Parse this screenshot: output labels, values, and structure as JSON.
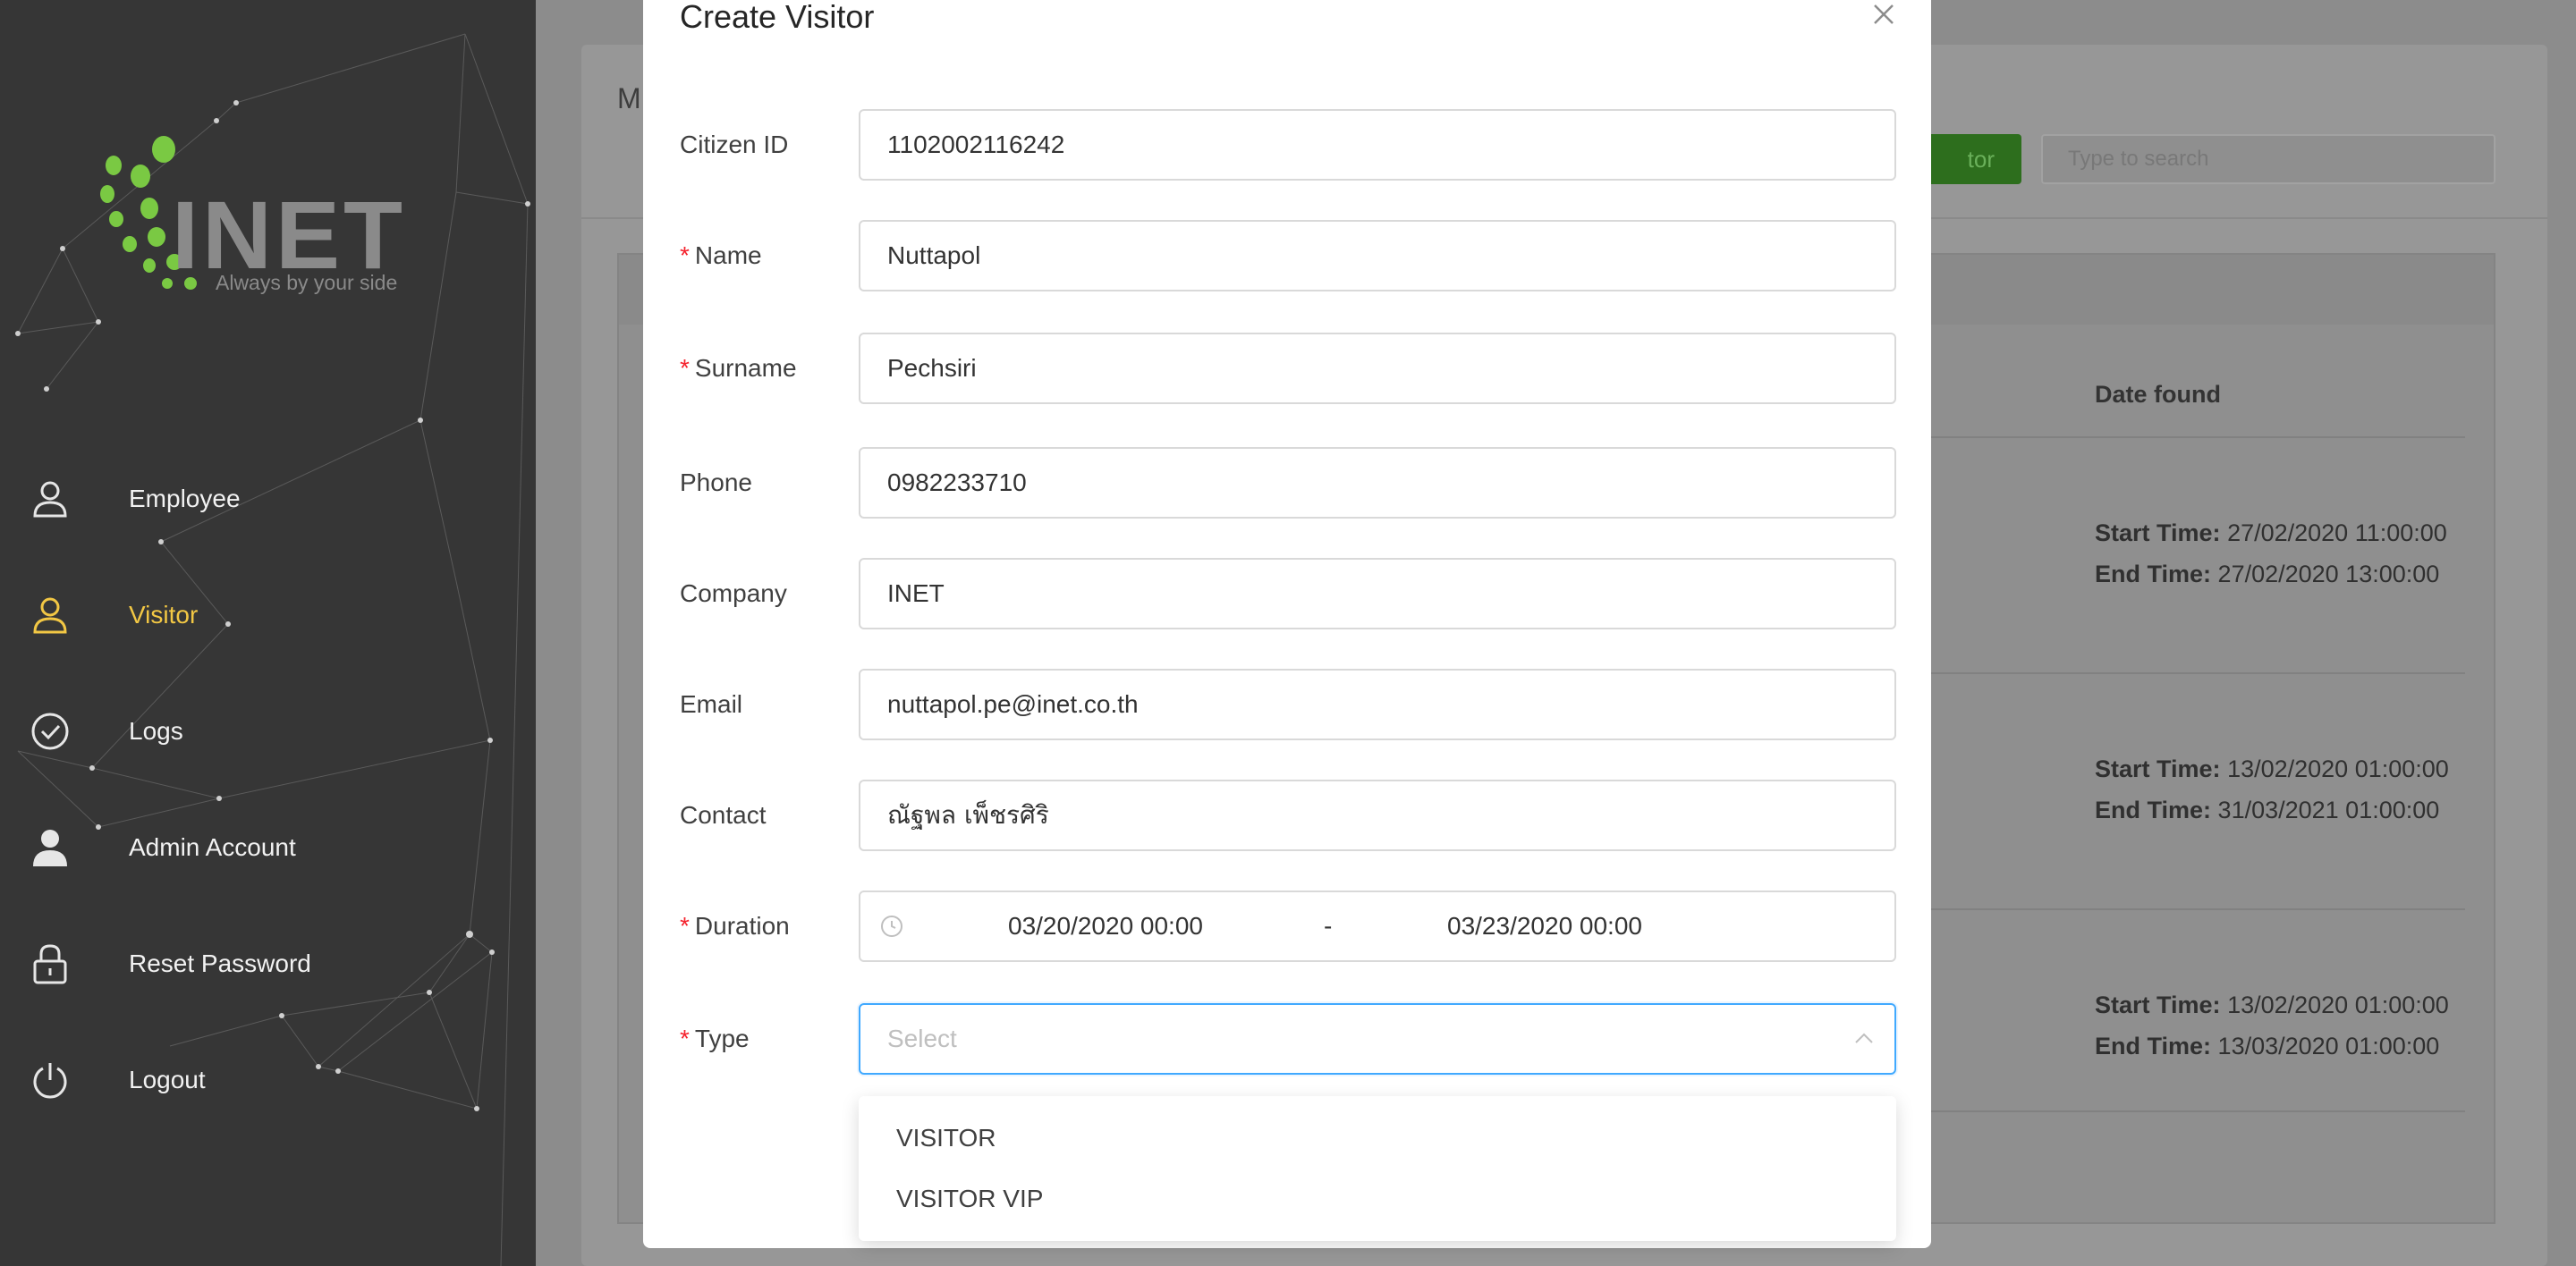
{
  "sidebar": {
    "logo": {
      "text": "INET",
      "tagline": "Always by your side"
    },
    "items": [
      {
        "label": "Employee",
        "icon": "user-icon",
        "active": false
      },
      {
        "label": "Visitor",
        "icon": "user-icon",
        "active": true
      },
      {
        "label": "Logs",
        "icon": "check-circle-icon",
        "active": false
      },
      {
        "label": "Admin Account",
        "icon": "user-filled-icon",
        "active": false
      },
      {
        "label": "Reset Password",
        "icon": "lock-icon",
        "active": false
      },
      {
        "label": "Logout",
        "icon": "power-icon",
        "active": false
      }
    ]
  },
  "background": {
    "title_fragment": "M",
    "add_button_fragment": "tor",
    "search_placeholder": "Type to search",
    "column_title": "Date found",
    "rows": [
      {
        "start_label": "Start Time:",
        "start": "27/02/2020 11:00:00",
        "end_label": "End Time:",
        "end": "27/02/2020 13:00:00"
      },
      {
        "start_label": "Start Time:",
        "start": "13/02/2020 01:00:00",
        "end_label": "End Time:",
        "end": "31/03/2021 01:00:00"
      },
      {
        "start_label": "Start Time:",
        "start": "13/02/2020 01:00:00",
        "end_label": "End Time:",
        "end": "13/03/2020 01:00:00"
      }
    ]
  },
  "modal": {
    "title": "Create Visitor",
    "fields": {
      "citizen_id": {
        "label": "Citizen ID",
        "value": "1102002116242",
        "required": false
      },
      "name": {
        "label": "Name",
        "value": "Nuttapol",
        "required": true
      },
      "surname": {
        "label": "Surname",
        "value": "Pechsiri",
        "required": true
      },
      "phone": {
        "label": "Phone",
        "value": "0982233710",
        "required": false
      },
      "company": {
        "label": "Company",
        "value": "INET",
        "required": false
      },
      "email": {
        "label": "Email",
        "value": "nuttapol.pe@inet.co.th",
        "required": false
      },
      "contact": {
        "label": "Contact",
        "value": "ณัฐพล เพ็ชรศิริ",
        "required": false
      },
      "duration": {
        "label": "Duration",
        "start": "03/20/2020 00:00",
        "separator": "-",
        "end": "03/23/2020 00:00",
        "required": true
      },
      "type": {
        "label": "Type",
        "placeholder": "Select",
        "required": true
      }
    },
    "required_mark": "*",
    "type_options": [
      "VISITOR",
      "VISITOR VIP"
    ]
  },
  "colors": {
    "sidebar_bg": "#363636",
    "active_nav": "#f2c744",
    "logo_green": "#7ac943",
    "required": "#f5222d",
    "focus_border": "#40a9ff",
    "add_button": "#2d6e1d"
  }
}
